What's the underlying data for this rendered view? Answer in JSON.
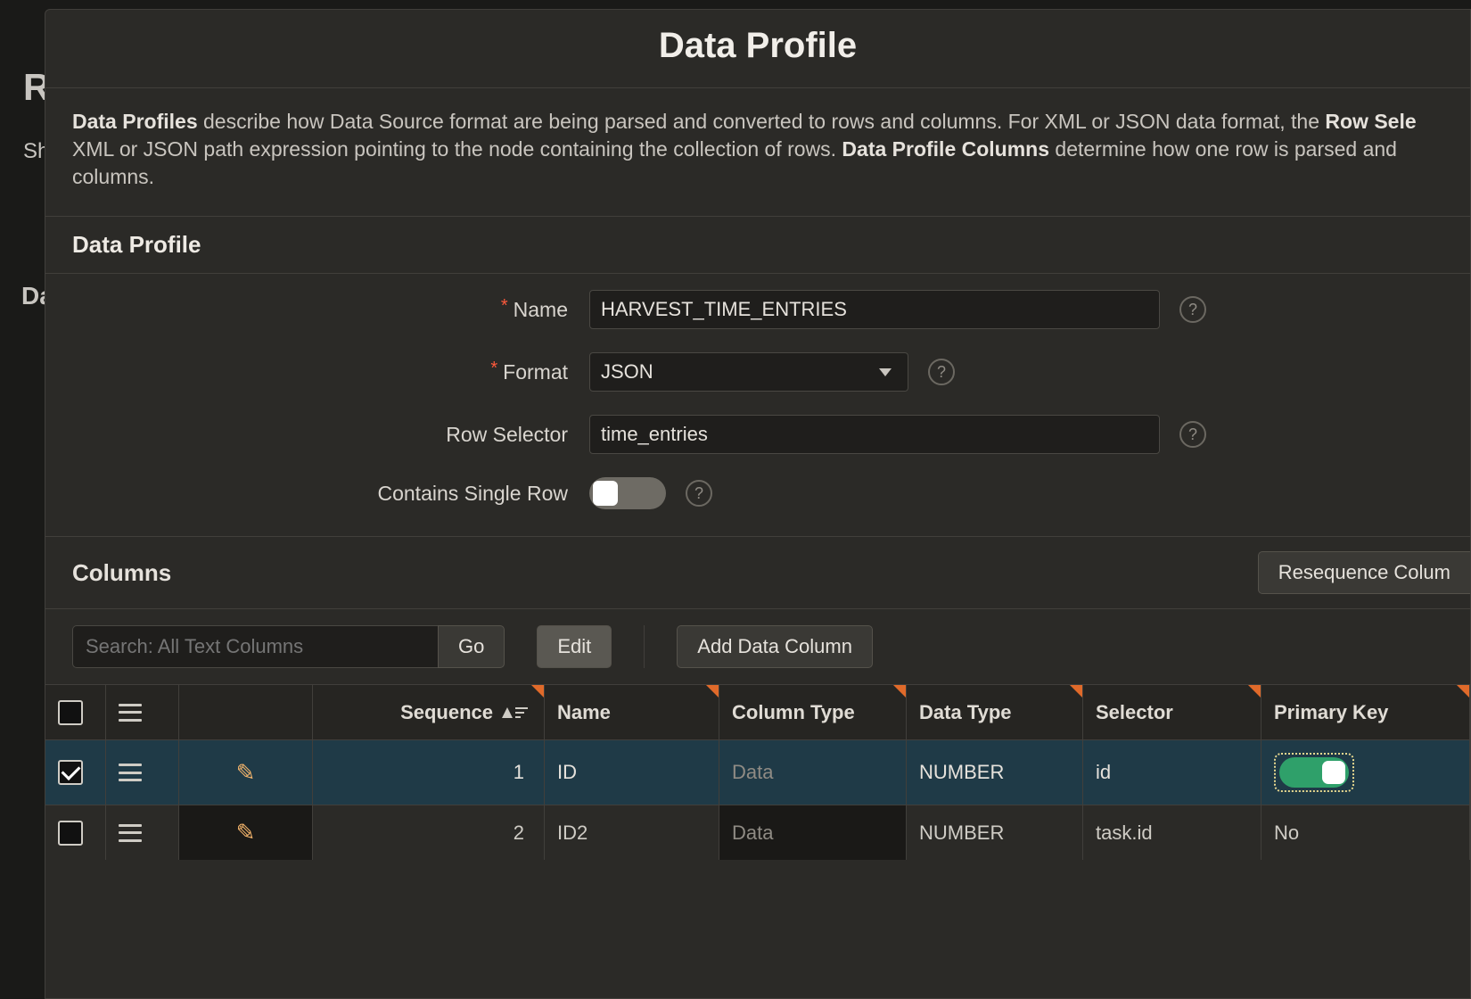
{
  "bg": {
    "r": "R",
    "sh": "Sh",
    "da": "Da"
  },
  "modal_title": "Data Profile",
  "description": {
    "t1_b": "Data Profiles",
    "t1": " describe how Data Source format are being parsed and converted to rows and columns. For XML or JSON data format, the ",
    "t2_b": "Row Sele",
    "t3": " XML or JSON path expression pointing to the node containing the collection of rows. ",
    "t4_b": "Data Profile Columns",
    "t5": " determine how one row is parsed and ",
    "t6": "columns."
  },
  "section_profile": "Data Profile",
  "form": {
    "name_label": "Name",
    "name_value": "HARVEST_TIME_ENTRIES",
    "format_label": "Format",
    "format_value": "JSON",
    "rowsel_label": "Row Selector",
    "rowsel_value": "time_entries",
    "single_label": "Contains Single Row"
  },
  "columns_header": "Columns",
  "resequence_btn": "Resequence Colum",
  "toolbar": {
    "search_placeholder": "Search: All Text Columns",
    "go": "Go",
    "edit": "Edit",
    "add": "Add Data Column"
  },
  "headers": {
    "sequence": "Sequence",
    "name": "Name",
    "coltype": "Column Type",
    "datatype": "Data Type",
    "selector": "Selector",
    "pk": "Primary Key"
  },
  "rows": [
    {
      "seq": "1",
      "name": "ID",
      "ctype": "Data",
      "dtype": "NUMBER",
      "sel": "id",
      "pk_on": true
    },
    {
      "seq": "2",
      "name": "ID2",
      "ctype": "Data",
      "dtype": "NUMBER",
      "sel": "task.id",
      "pk_text": "No"
    }
  ]
}
